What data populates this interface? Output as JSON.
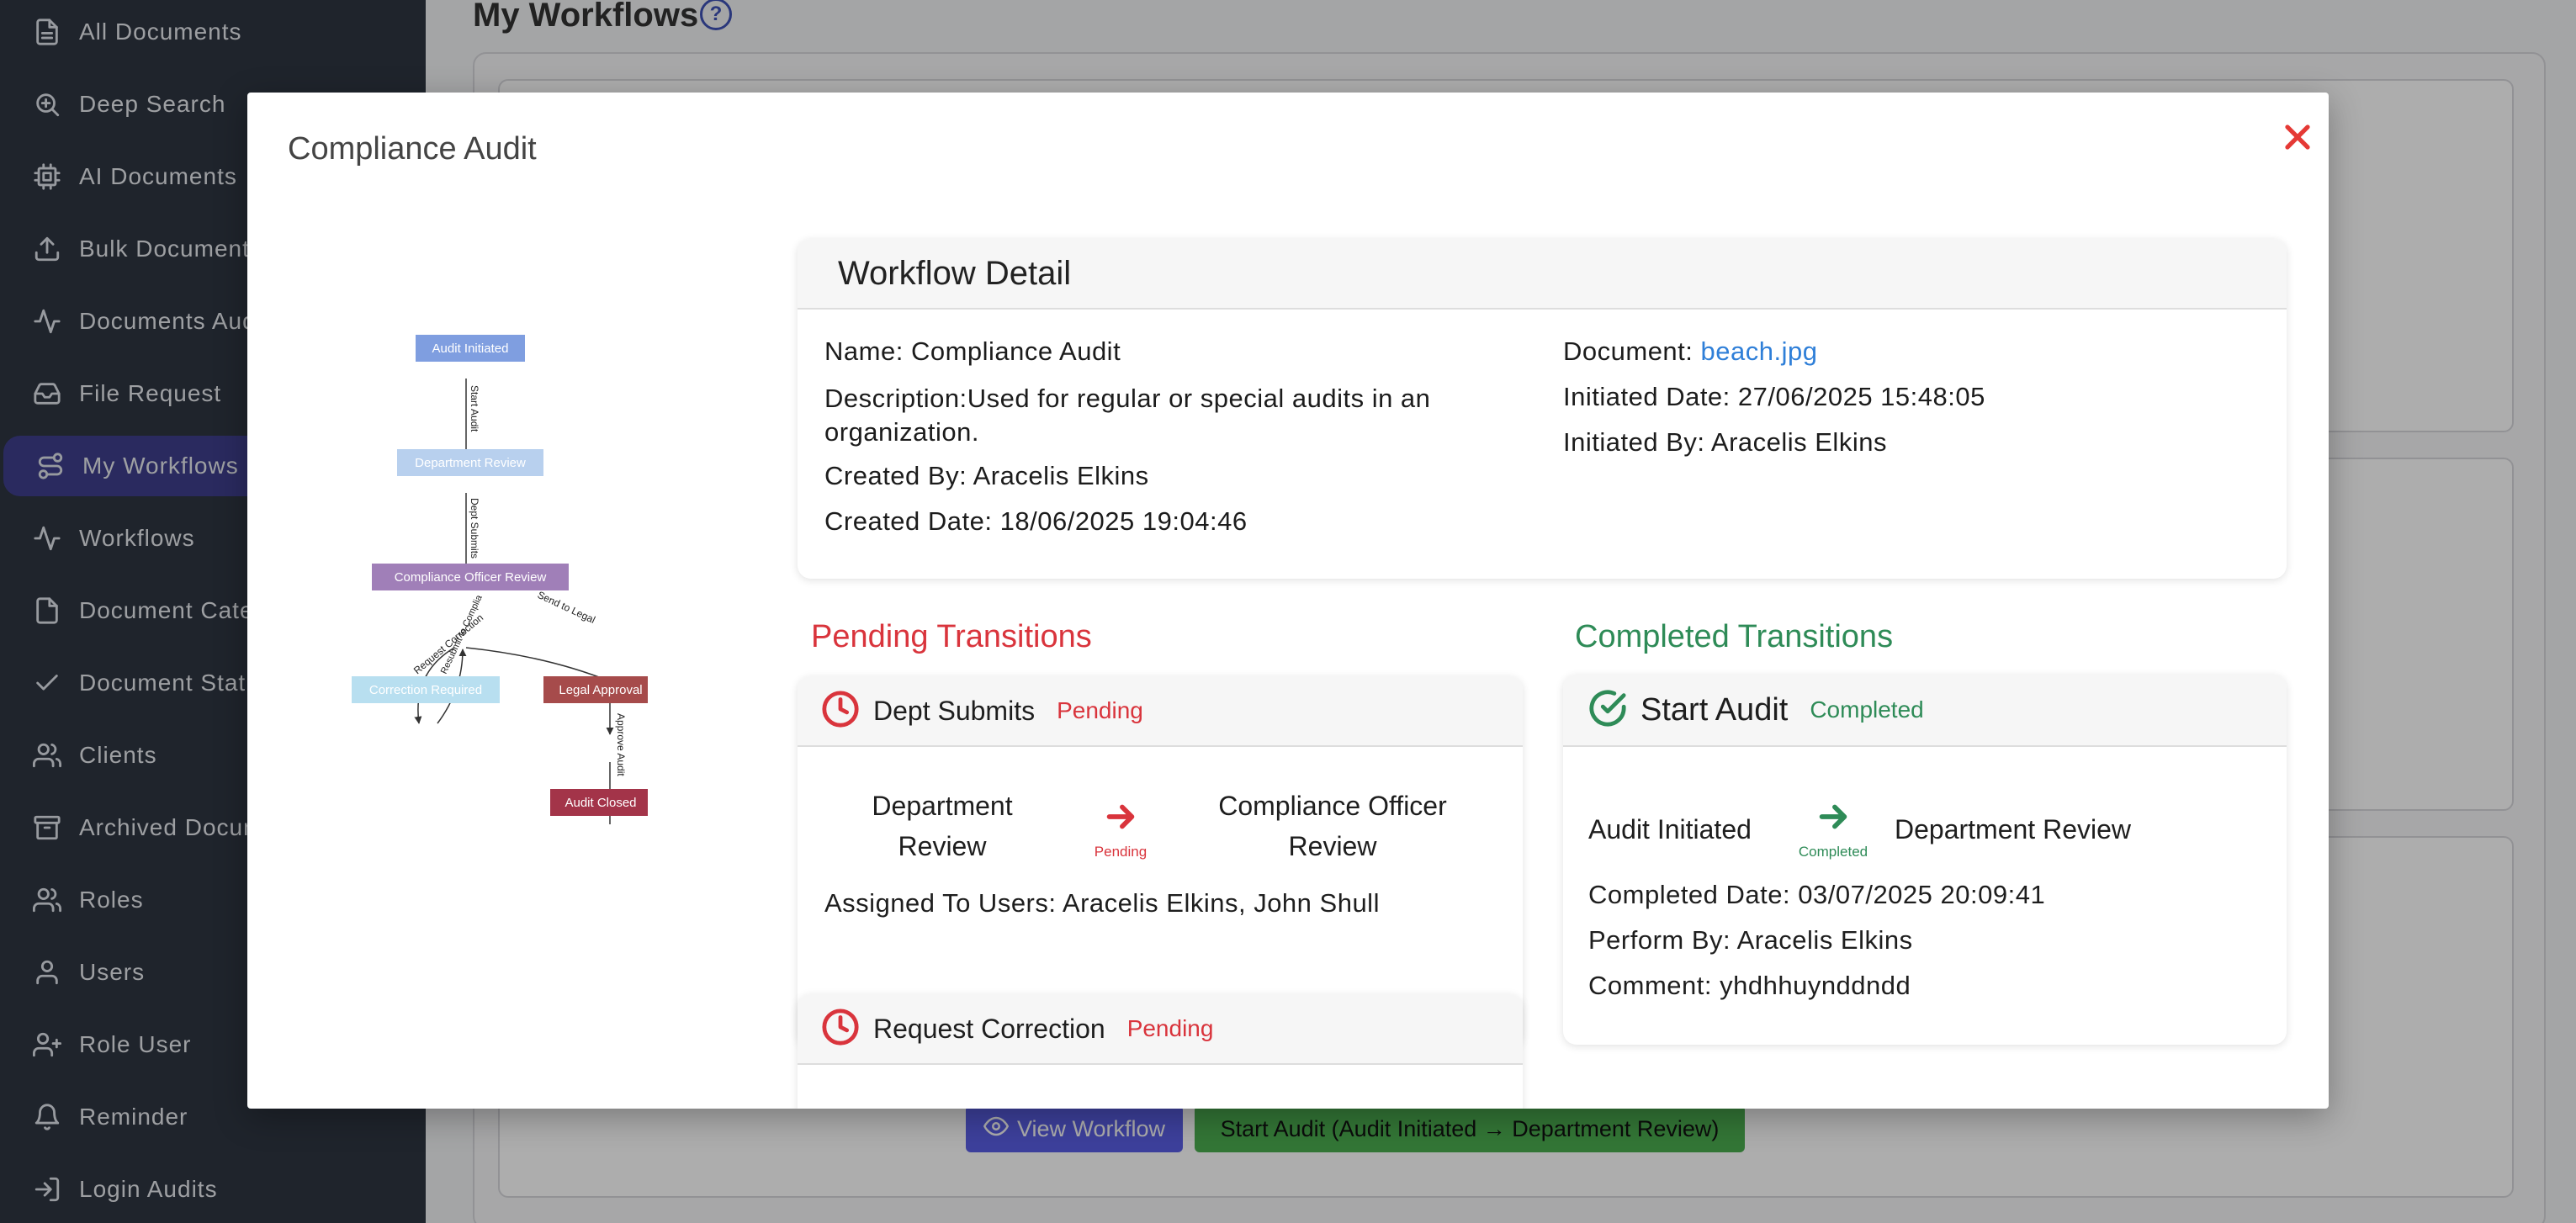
{
  "sidebar": {
    "items": [
      {
        "label": "All Documents",
        "icon": "document-icon"
      },
      {
        "label": "Deep Search",
        "icon": "search-icon"
      },
      {
        "label": "AI Documents",
        "icon": "cpu-icon"
      },
      {
        "label": "Bulk Document",
        "icon": "upload-icon"
      },
      {
        "label": "Documents Aud",
        "icon": "activity-icon"
      },
      {
        "label": "File Request",
        "icon": "inbox-icon"
      },
      {
        "label": "My Workflows",
        "icon": "workflow-icon"
      },
      {
        "label": "Workflows",
        "icon": "activity-icon"
      },
      {
        "label": "Document Cate",
        "icon": "document-icon"
      },
      {
        "label": "Document Stat",
        "icon": "check-icon"
      },
      {
        "label": "Clients",
        "icon": "users-icon"
      },
      {
        "label": "Archived Docum",
        "icon": "archive-icon"
      },
      {
        "label": "Roles",
        "icon": "users-icon"
      },
      {
        "label": "Users",
        "icon": "user-icon"
      },
      {
        "label": "Role User",
        "icon": "user-plus-icon"
      },
      {
        "label": "Reminder",
        "icon": "bell-icon"
      },
      {
        "label": "Login Audits",
        "icon": "login-icon"
      }
    ]
  },
  "page": {
    "title": "My Workflows",
    "help": "?",
    "view_workflow_label": "View Workflow",
    "transition_label": "Start Audit (Audit Initiated → Department Review)"
  },
  "modal": {
    "title": "Compliance Audit",
    "diagram": {
      "nodes": {
        "n1": "Audit Initiated",
        "n2": "Department Review",
        "n3": "Compliance Officer Review",
        "n4": "Correction Required",
        "n5": "Legal Approval",
        "n6": "Audit Closed"
      },
      "edges": {
        "e1": "Start Audit",
        "e2": "Dept Submits",
        "e3": "Send to Legal",
        "e4": "Request Correction",
        "e5": "Resubmit to Complia",
        "e6": "Approve Audit"
      }
    },
    "detail": {
      "heading": "Workflow Detail",
      "name_label": "Name:",
      "name": "Compliance Audit",
      "description_label": "Description:",
      "description": "Used for regular or special audits in an organization.",
      "created_by_label": "Created By:",
      "created_by": "Aracelis Elkins",
      "created_date_label": "Created Date:",
      "created_date": "18/06/2025 19:04:46",
      "document_label": "Document:",
      "document": "beach.jpg",
      "initiated_date_label": "Initiated Date:",
      "initiated_date": "27/06/2025 15:48:05",
      "initiated_by_label": "Initiated By:",
      "initiated_by": "Aracelis Elkins"
    },
    "pending": {
      "heading": "Pending Transitions",
      "items": [
        {
          "title": "Dept Submits",
          "status": "Pending",
          "from": "Department Review",
          "to": "Compliance Officer Review",
          "arrow_status": "Pending",
          "assigned_label": "Assigned To Users:",
          "assigned": "Aracelis Elkins, John Shull"
        },
        {
          "title": "Request Correction",
          "status": "Pending"
        }
      ]
    },
    "completed": {
      "heading": "Completed Transitions",
      "items": [
        {
          "title": "Start Audit",
          "status": "Completed",
          "from": "Audit Initiated",
          "to": "Department Review",
          "arrow_status": "Completed",
          "completed_date_label": "Completed Date:",
          "completed_date": "03/07/2025 20:09:41",
          "perform_by_label": "Perform By:",
          "perform_by": "Aracelis Elkins",
          "comment_label": "Comment:",
          "comment": "yhdhhuynddndd"
        }
      ]
    }
  },
  "colors": {
    "sidebar_bg": "#2f3542",
    "sidebar_active": "#3e3f8c",
    "pending": "#d9343c",
    "completed": "#2e8b57",
    "link": "#2f7fd8",
    "close": "#e53935"
  }
}
